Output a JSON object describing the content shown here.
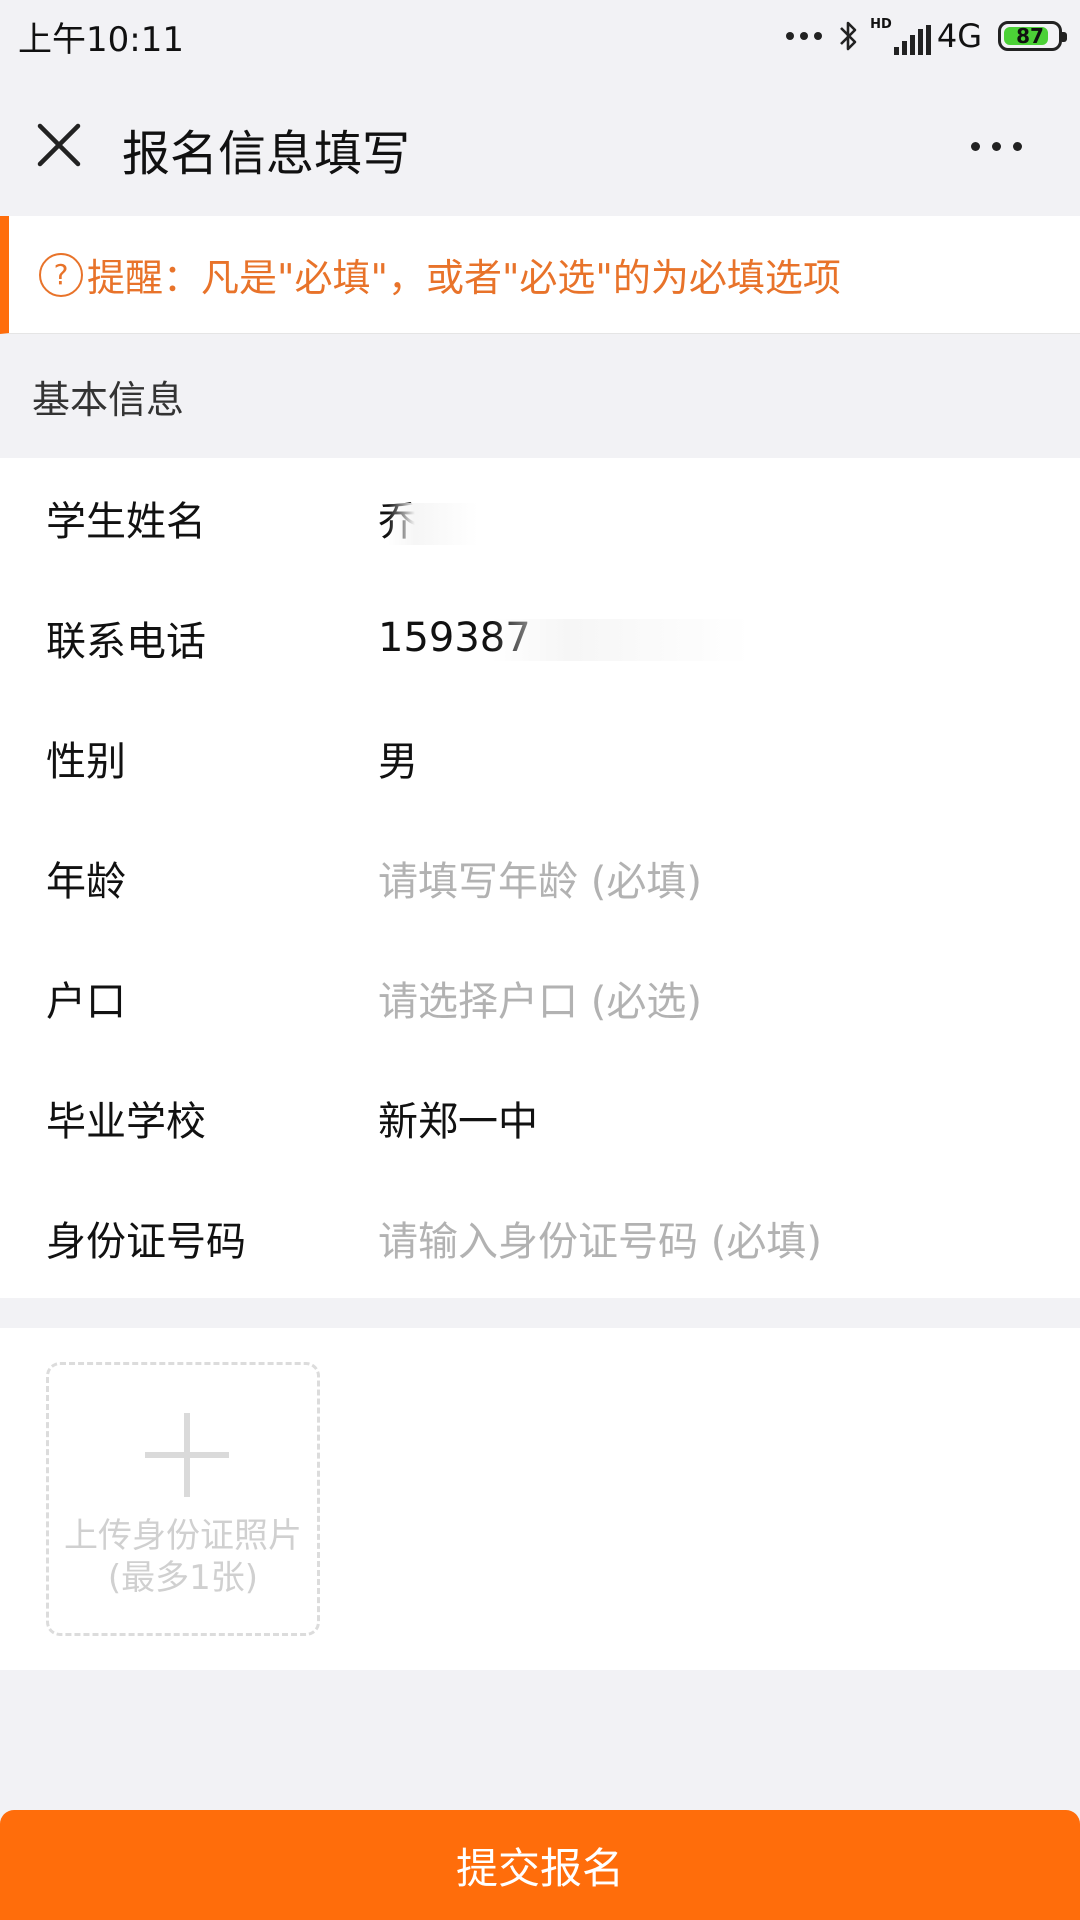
{
  "status_bar": {
    "time": "上午10:11",
    "network_badge": "HD",
    "network": "4G",
    "battery": "87",
    "battery_color": "#4cd137"
  },
  "nav": {
    "title": "报名信息填写",
    "close_icon": "close-icon",
    "more_icon": "more-icon"
  },
  "notice": {
    "icon": "question-icon",
    "icon_glyph": "?",
    "text": "提醒：凡是\"必填\"，或者\"必选\"的为必填选项",
    "color": "#e8732a"
  },
  "section": {
    "title": "基本信息"
  },
  "form": {
    "rows": [
      {
        "label": "学生姓名",
        "value": "乔",
        "placeholder": ""
      },
      {
        "label": "联系电话",
        "value": "159387",
        "placeholder": ""
      },
      {
        "label": "性别",
        "value": "男",
        "placeholder": ""
      },
      {
        "label": "年龄",
        "value": "",
        "placeholder": "请填写年龄 (必填)"
      },
      {
        "label": "户口",
        "value": "",
        "placeholder": "请选择户口 (必选)"
      },
      {
        "label": "毕业学校",
        "value": "新郑一中",
        "placeholder": ""
      },
      {
        "label": "身份证号码",
        "value": "",
        "placeholder": "请输入身份证号码 (必填)"
      }
    ]
  },
  "upload": {
    "line1": "上传身份证照片",
    "line2": "(最多1张)"
  },
  "submit": {
    "label": "提交报名",
    "color": "#ff6d0b"
  }
}
